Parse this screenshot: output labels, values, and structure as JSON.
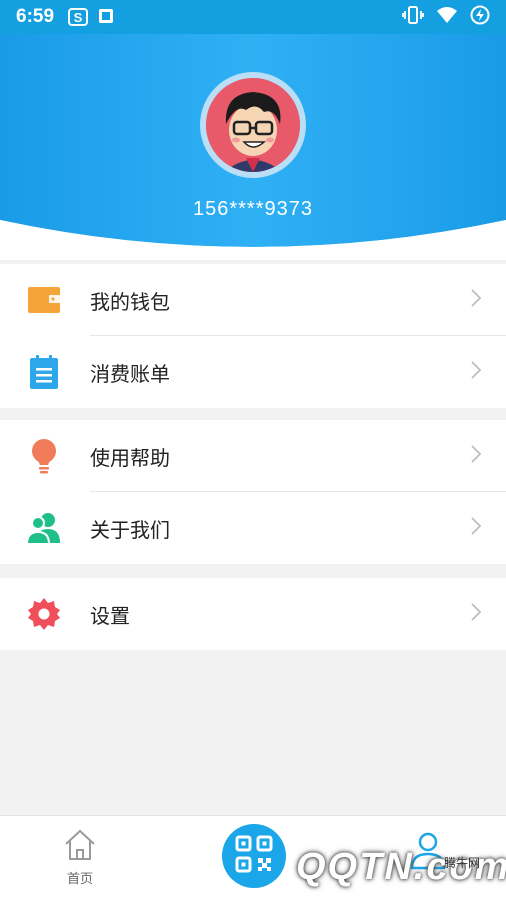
{
  "status_bar": {
    "time": "6:59",
    "icons_left": [
      "sogou-s-icon",
      "notification-app-icon"
    ],
    "icons_right": [
      "vibrate-icon",
      "wifi-icon",
      "battery-charging-icon"
    ]
  },
  "profile": {
    "phone": "156****9373",
    "avatar_icon": "cartoon-avatar"
  },
  "menu_groups": [
    [
      {
        "label": "我的钱包",
        "icon": "wallet-icon",
        "color": "#f5a43a"
      },
      {
        "label": "消费账单",
        "icon": "bill-icon",
        "color": "#2ea7ea"
      }
    ],
    [
      {
        "label": "使用帮助",
        "icon": "lightbulb-icon",
        "color": "#f07c5a"
      },
      {
        "label": "关于我们",
        "icon": "users-icon",
        "color": "#1fbf8a"
      }
    ],
    [
      {
        "label": "设置",
        "icon": "settings-gear-icon",
        "color": "#ef4f5a"
      }
    ]
  ],
  "bottom_nav": {
    "home_label": "首页",
    "scan_icon": "qr-scan-icon",
    "me_icon": "user-icon"
  },
  "watermark": {
    "text": "QQTN.com",
    "small": "腾牛网"
  },
  "colors": {
    "header_blue": "#1ea3ea",
    "accent": "#1aa6e8",
    "background": "#f2f2f2"
  }
}
